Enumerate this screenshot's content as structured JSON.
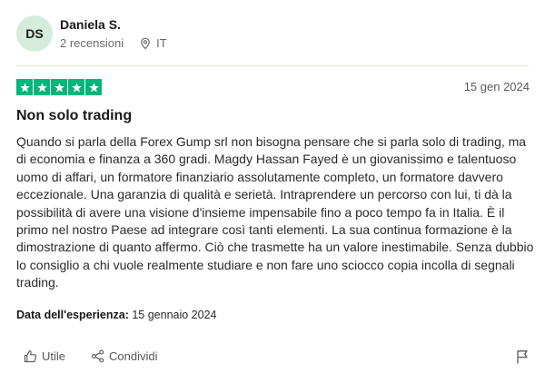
{
  "reviewer": {
    "initials": "DS",
    "name": "Daniela S.",
    "reviews_count": "2 recensioni",
    "country": "IT"
  },
  "review": {
    "rating": 5,
    "date": "15 gen 2024",
    "title": "Non solo trading",
    "body": "Quando si parla della Forex Gump srl non bisogna pensare che si parla solo di trading, ma di economia e finanza a 360 gradi. Magdy Hassan Fayed è un giovanissimo e talentuoso uomo di affari, un formatore finanziario assolutamente completo, un formatore davvero eccezionale. Una garanzia di qualità e serietà. Intraprendere un percorso con lui, ti dà la possibilità di avere una visione d'insieme impensabile fino a poco tempo fa in Italia. È il primo nel nostro Paese ad integrare così tanti elementi. La sua continua formazione è la dimostrazione di quanto affermo. Ciò che trasmette ha un valore inestimabile. Senza dubbio lo consiglio a chi vuole realmente studiare e non fare uno sciocco copia incolla di segnali trading.",
    "experience_label": "Data dell'esperienza:",
    "experience_date": "15 gennaio 2024"
  },
  "actions": {
    "useful_label": "Utile",
    "share_label": "Condividi"
  },
  "colors": {
    "star_green": "#00b67a",
    "avatar_bg": "#d5ecdc"
  }
}
